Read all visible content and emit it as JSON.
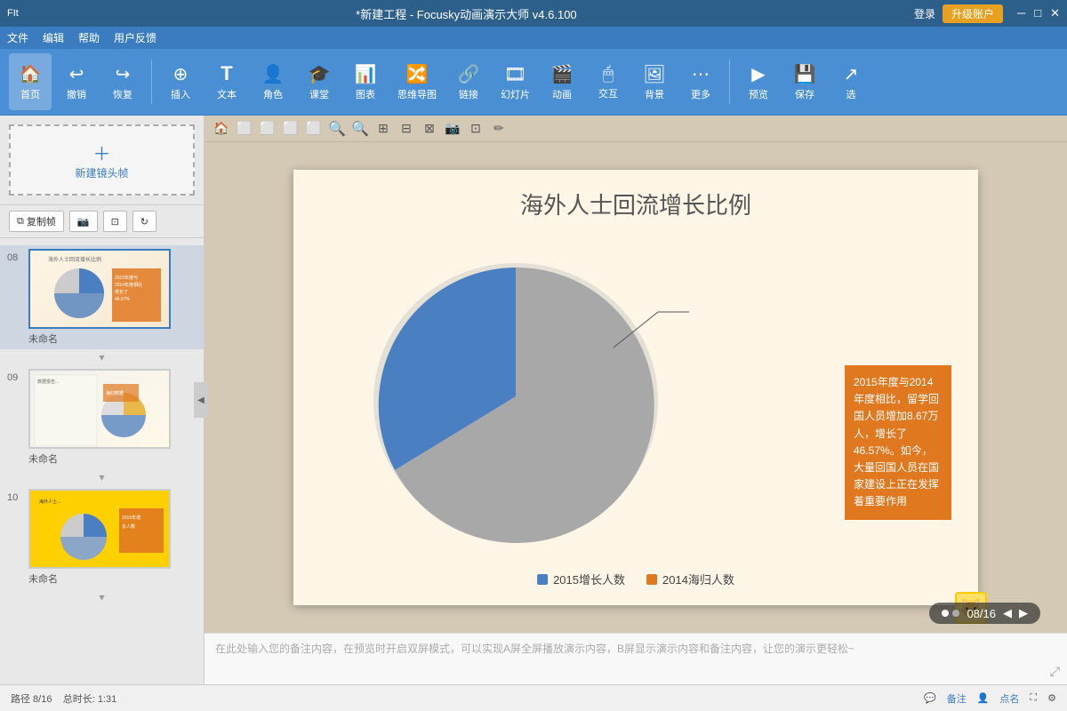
{
  "titlebar": {
    "title": "*新建工程 - Focusky动画演示大师 v4.6.100",
    "login": "登录",
    "upgrade": "升级账户"
  },
  "menubar": {
    "items": [
      "文件",
      "编辑",
      "帮助",
      "用户反馈"
    ]
  },
  "toolbar": {
    "items": [
      {
        "id": "home",
        "icon": "🏠",
        "label": "首页"
      },
      {
        "id": "undo",
        "icon": "↩",
        "label": "撤销"
      },
      {
        "id": "redo",
        "icon": "↪",
        "label": "恢复"
      },
      {
        "id": "insert",
        "icon": "⊕",
        "label": "插入"
      },
      {
        "id": "text",
        "icon": "T",
        "label": "文本"
      },
      {
        "id": "character",
        "icon": "👤",
        "label": "角色"
      },
      {
        "id": "class",
        "icon": "🏫",
        "label": "课堂"
      },
      {
        "id": "chart",
        "icon": "📊",
        "label": "图表"
      },
      {
        "id": "mindmap",
        "icon": "🔀",
        "label": "思维导图"
      },
      {
        "id": "link",
        "icon": "🔗",
        "label": "链接"
      },
      {
        "id": "slide",
        "icon": "🎞",
        "label": "幻灯片"
      },
      {
        "id": "animate",
        "icon": "🎬",
        "label": "动画"
      },
      {
        "id": "interact",
        "icon": "🖱",
        "label": "交互"
      },
      {
        "id": "background",
        "icon": "🖼",
        "label": "背景"
      },
      {
        "id": "more",
        "icon": "⋯",
        "label": "更多"
      },
      {
        "id": "preview",
        "icon": "▶",
        "label": "预览"
      },
      {
        "id": "save",
        "icon": "💾",
        "label": "保存"
      },
      {
        "id": "select",
        "icon": "↗",
        "label": "选"
      }
    ]
  },
  "sidebar": {
    "new_frame_label": "新建镜头帧",
    "copy_frame": "复制帧",
    "slides": [
      {
        "num": "08",
        "label": "未命名",
        "active": true
      },
      {
        "num": "09",
        "label": "未命名",
        "active": false
      },
      {
        "num": "10",
        "label": "未命名",
        "active": false
      }
    ]
  },
  "canvas": {
    "tools": [
      "🏠",
      "⬜",
      "⬜",
      "⬜",
      "⬜",
      "🔍+",
      "🔍-",
      "⊞",
      "⊟",
      "⊠",
      "📷",
      "⊡",
      "✏"
    ]
  },
  "slide": {
    "title": "海外人士回流增长比例",
    "callout_text": "2015年度与2014年度相比，留学回国人员增加8.67万人，增长了46.57%。如今，大量回国人员在国家建设上正在发挥着重要作用",
    "legend": [
      {
        "label": "2015增长人数",
        "color": "#4a7fc1"
      },
      {
        "label": "2014海归人数",
        "color": "#e07820"
      }
    ],
    "nav_number": "8"
  },
  "page_indicator": {
    "text": "08/16"
  },
  "notes": {
    "placeholder": "在此处输入您的备注内容，在预览时开启双屏模式，可以实现A屏全屏播放演示内容，B屏显示演示内容和备注内容，让您的演示更轻松~"
  },
  "statusbar": {
    "path": "路径 8/16",
    "duration": "总时长: 1:31",
    "notes_btn": "备注",
    "points_btn": "点名"
  }
}
